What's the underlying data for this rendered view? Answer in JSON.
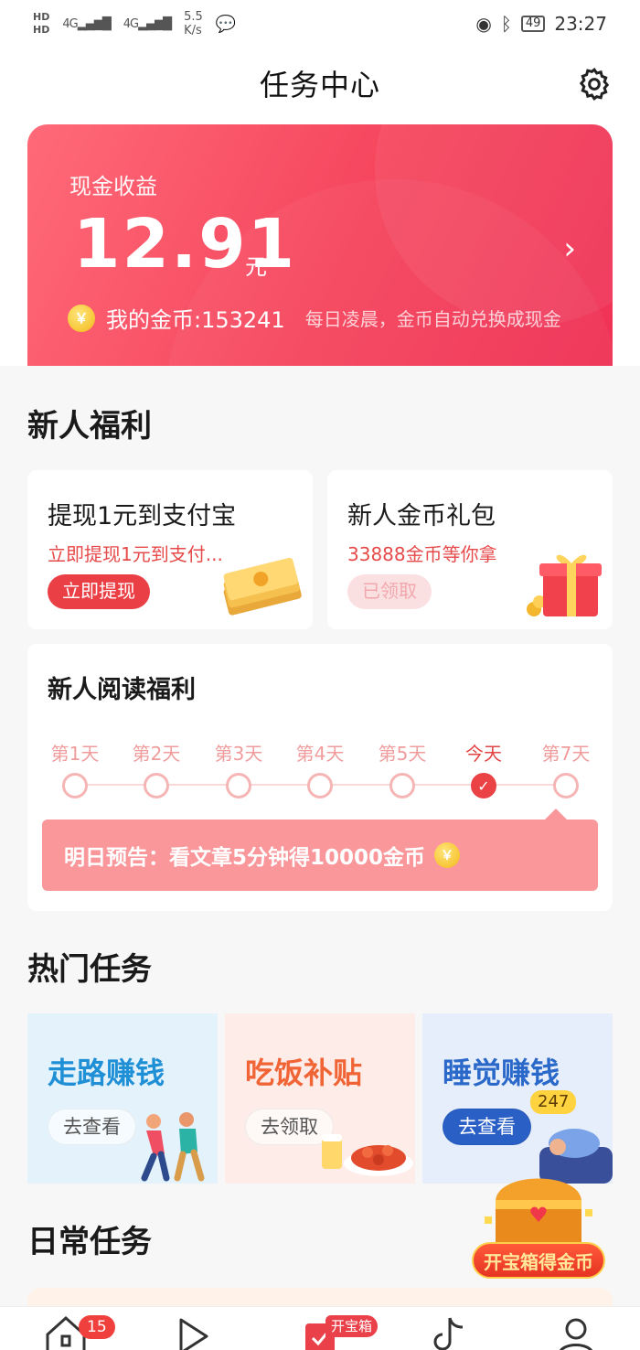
{
  "status_bar": {
    "hd1": "HD",
    "hd2": "HD",
    "net1": "4G",
    "net2": "4G",
    "speed_value": "5.5",
    "speed_unit": "K/s",
    "battery": "49",
    "time": "23:27"
  },
  "header": {
    "title": "任务中心"
  },
  "earnings": {
    "label": "现金收益",
    "amount": "12.91",
    "unit": "元",
    "coin_symbol": "￥",
    "coins_text": "我的金币:153241",
    "coins_note": "每日凌晨，金币自动兑换成现金"
  },
  "newbie": {
    "section_title": "新人福利",
    "cards": [
      {
        "title": "提现1元到支付宝",
        "subtitle": "立即提现1元到支付...",
        "button": "立即提现"
      },
      {
        "title": "新人金币礼包",
        "subtitle": "33888金币等你拿",
        "button": "已领取"
      }
    ]
  },
  "reading": {
    "title": "新人阅读福利",
    "days": [
      "第1天",
      "第2天",
      "第3天",
      "第4天",
      "第5天",
      "今天",
      "第7天"
    ],
    "today_index": 5,
    "notice": "明日预告：看文章5分钟得10000金币",
    "notice_coin": "￥"
  },
  "hot_tasks": {
    "section_title": "热门任务",
    "items": [
      {
        "title": "走路赚钱",
        "button": "去查看",
        "title_color": "#1f8fd6",
        "bg": "#e3f2fb"
      },
      {
        "title": "吃饭补贴",
        "button": "去领取",
        "title_color": "#f06436",
        "bg": "#fdece7"
      },
      {
        "title": "睡觉赚钱",
        "button": "去查看",
        "title_color": "#2a69c9",
        "bg": "#e6eefb",
        "badge": "247"
      }
    ]
  },
  "daily": {
    "section_title": "日常任务"
  },
  "treasure": {
    "label": "开宝箱得金币"
  },
  "tab_bar": {
    "home_badge": "15",
    "open_box_badge": "开宝箱"
  },
  "colors": {
    "accent": "#ea3f45",
    "card_gradient_start": "#ff6a78",
    "card_gradient_end": "#ef3156"
  }
}
